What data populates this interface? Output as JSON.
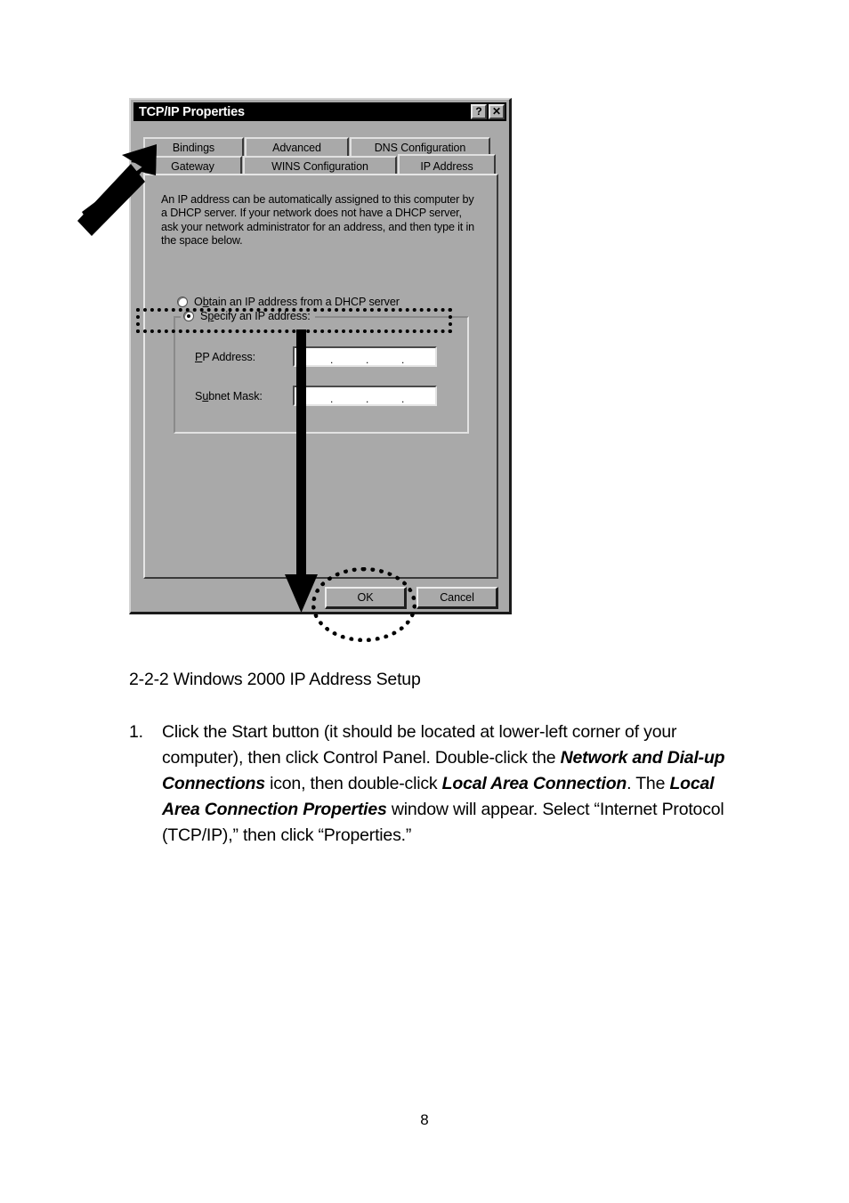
{
  "dialog": {
    "title": "TCP/IP Properties",
    "titlebar_buttons": [
      {
        "name": "help-button",
        "glyph": "?"
      },
      {
        "name": "close-button",
        "glyph": "✕"
      }
    ],
    "tabs_row1": [
      {
        "label": "Bindings",
        "active": false
      },
      {
        "label": "Advanced",
        "active": false
      },
      {
        "label": "DNS Configuration",
        "active": false
      }
    ],
    "tabs_row2": [
      {
        "label": "Gateway",
        "active": false
      },
      {
        "label": "WINS Configuration",
        "active": false
      },
      {
        "label": "IP Address",
        "active": true
      }
    ],
    "description": "An IP address can be automatically assigned to this computer by a DHCP server. If your network does not have a DHCP server, ask your network administrator for an address, and then type it in the space below.",
    "radio_obtain": {
      "label_before": "O",
      "label_accel": "b",
      "label_after": "tain an IP address from a DHCP server",
      "label": "Obtain an IP address from a DHCP server",
      "selected": false
    },
    "radio_specify": {
      "label_before": "S",
      "label_accel": "p",
      "label_after": "ecify an IP address:",
      "label": "Specify an IP address:",
      "selected": true
    },
    "fields": [
      {
        "name": "ip-address-field",
        "label": "IP Address:",
        "label_accel": "P",
        "octets": [
          "",
          "",
          "",
          ""
        ],
        "separators": [
          ".",
          ".",
          "."
        ]
      },
      {
        "name": "subnet-mask-field",
        "label": "Subnet Mask:",
        "label_accel": "u",
        "octets": [
          "",
          "",
          "",
          ""
        ],
        "separators": [
          ".",
          ".",
          "."
        ]
      }
    ],
    "buttons": [
      {
        "name": "ok-button",
        "label": "OK"
      },
      {
        "name": "cancel-button",
        "label": "Cancel"
      }
    ],
    "annotations": {
      "highlight_rect_target": "Specify an IP address:",
      "highlight_ellipse_target": "OK",
      "pointer_arrow_target": "Specify an IP address:",
      "flow_arrow_target": "OK"
    }
  },
  "document": {
    "section_heading": "2-2-2 Windows 2000 IP Address Setup",
    "list_items": [
      {
        "number": "1.",
        "segments": [
          {
            "text": "Click the Start button (it should be located at lower-left corner of your computer), then click Control Panel. Double-click the ",
            "bold": false
          },
          {
            "text": "Network and Dial-up Connections",
            "bold": true
          },
          {
            "text": " icon, then double-click ",
            "bold": false
          },
          {
            "text": "Local Area Connection",
            "bold": true
          },
          {
            "text": ". The ",
            "bold": false
          },
          {
            "text": "Local Area Connection Properties",
            "bold": true
          },
          {
            "text": " window will appear. Select “Internet Protocol (TCP/IP),” then click “Properties.”",
            "bold": false
          }
        ]
      }
    ],
    "page_number": "8"
  },
  "colors": {
    "dialog_face": "#a9a9a9",
    "titlebar": "#000000",
    "titlebar_text": "#ffffff",
    "field_bg": "#ffffff",
    "annotation": "#000000",
    "page_bg": "#ffffff"
  }
}
